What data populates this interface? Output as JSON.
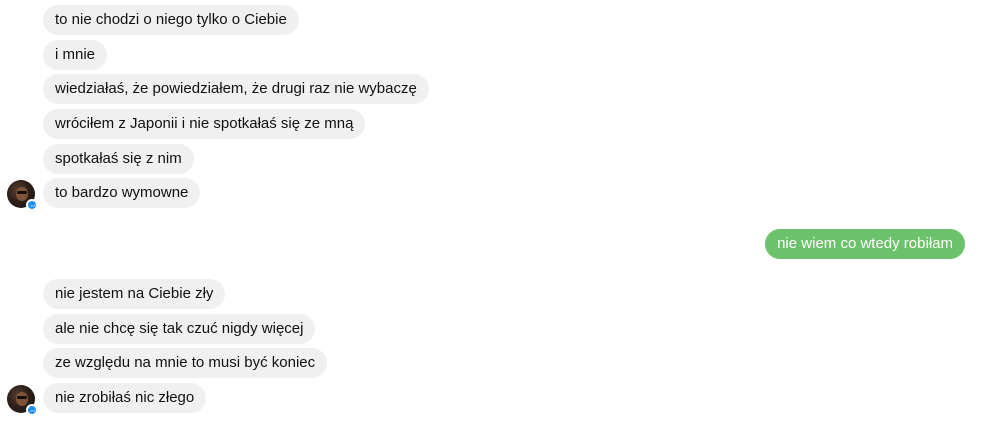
{
  "colors": {
    "incoming_bubble": "#f0f0f0",
    "outgoing_bubble": "#6cc26a",
    "messenger_badge": "#1f8ef1"
  },
  "conversation": {
    "group1": [
      {
        "text": "to nie chodzi o niego tylko o Ciebie"
      },
      {
        "text": "i mnie"
      },
      {
        "text": "wiedziałaś, że powiedziałem, że drugi raz nie wybaczę"
      },
      {
        "text": "wróciłem z Japonii i nie spotkałaś się ze mną"
      },
      {
        "text": "spotkałaś się z nim"
      },
      {
        "text": "to bardzo wymowne"
      }
    ],
    "outgoing": [
      {
        "text": "nie wiem co wtedy robiłam"
      }
    ],
    "group2": [
      {
        "text": "nie jestem na Ciebie zły"
      },
      {
        "text": "ale nie chcę się tak czuć nigdy więcej"
      },
      {
        "text": "ze względu na mnie to musi być koniec"
      },
      {
        "text": "nie zrobiłaś nic złego"
      }
    ],
    "sender_avatar_icon": "profile-photo",
    "platform_badge_icon": "messenger-icon"
  }
}
